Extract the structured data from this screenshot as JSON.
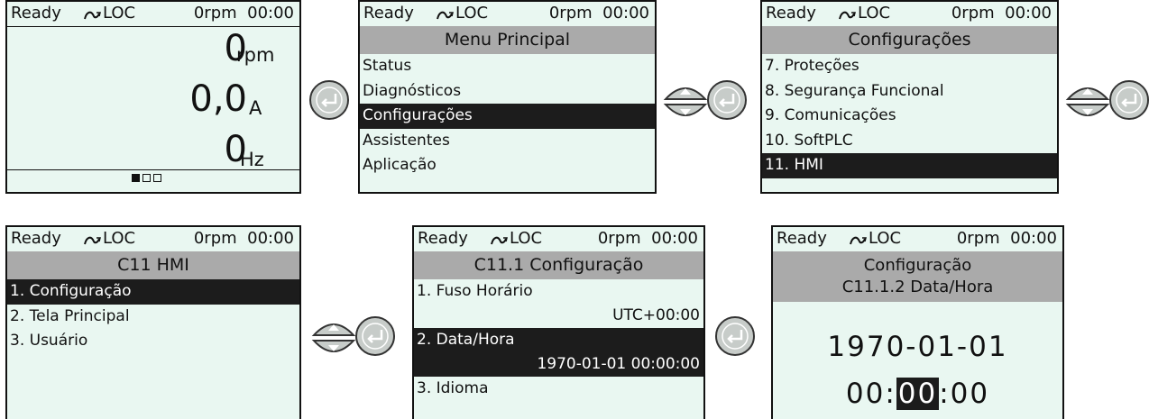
{
  "status": {
    "ready": "Ready",
    "loc": "LOC",
    "rpm_time": "0rpm  00:00"
  },
  "monitor": {
    "speed_value": "0",
    "speed_unit": "rpm",
    "current_value": "0,0",
    "current_unit": "A",
    "freq_value": "0",
    "freq_unit": "Hz",
    "page_indicator": {
      "pages": 3,
      "active": 1
    }
  },
  "main_menu": {
    "title": "Menu Principal",
    "items": [
      "Status",
      "Diagnósticos",
      "Configurações",
      "Assistentes",
      "Aplicação"
    ],
    "selected_index": 2
  },
  "config_menu": {
    "title": "Configurações",
    "items": [
      "7. Proteções",
      "8. Segurança Funcional",
      "9. Comunicações",
      "10. SoftPLC",
      "11. HMI"
    ],
    "selected_index": 4
  },
  "hmi_menu": {
    "title": "C11 HMI",
    "items": [
      "1. Configuração",
      "2. Tela Principal",
      "3. Usuário"
    ],
    "selected_index": 0
  },
  "hmi_config": {
    "title": "C11.1 Configuração",
    "fuso_label": "1. Fuso Horário",
    "fuso_value": "UTC+00:00",
    "data_label": "2. Data/Hora",
    "data_value": "1970-01-01 00:00:00",
    "idioma_label": "3. Idioma"
  },
  "datetime": {
    "title_line1": "Configuração",
    "title_line2": "C11.1.2 Data/Hora",
    "date": "1970-01-01",
    "time_hh": "00:",
    "time_mm": "00",
    "time_ss": ":00"
  },
  "keys": {
    "enter_icon": "enter-key-icon",
    "nav_icon": "up-down-navigation-icon"
  },
  "colors": {
    "screen_bg": "#e9f7f1",
    "title_bar": "#aaaaaa",
    "selection": "#1c1c1c",
    "key_fill": "#c7ccc9"
  }
}
